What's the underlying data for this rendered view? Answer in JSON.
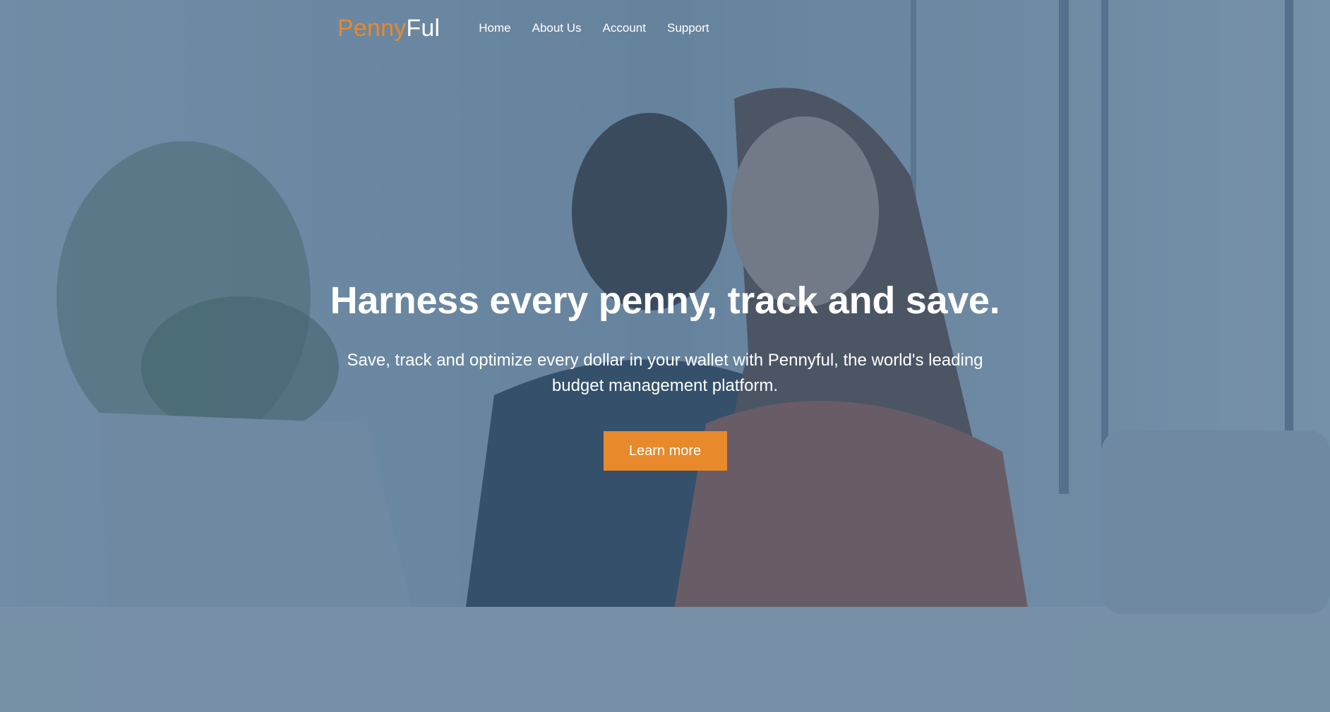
{
  "brand": {
    "part1": "Penny",
    "part2": "Ful",
    "accent_color": "#e8892b"
  },
  "nav": {
    "items": [
      {
        "label": "Home"
      },
      {
        "label": "About Us"
      },
      {
        "label": "Account"
      },
      {
        "label": "Support"
      }
    ]
  },
  "hero": {
    "headline": "Harness every penny, track and save.",
    "subtext": "Save, track and optimize every dollar in your wallet with Pennyful, the world's leading budget management platform.",
    "cta_label": "Learn more",
    "overlay_color": "#3a6082",
    "background": "photo of a couple using a credit card at a laptop"
  }
}
